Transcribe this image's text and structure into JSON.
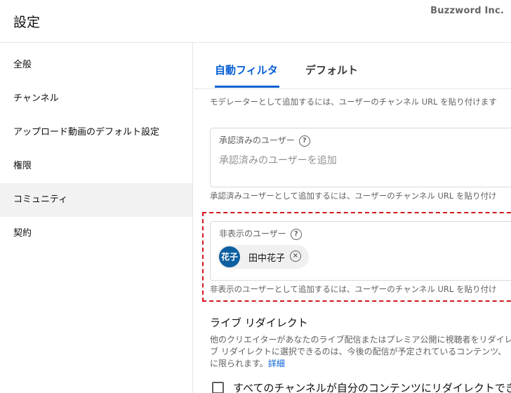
{
  "header": {
    "title": "設定",
    "watermark": "Buzzword Inc."
  },
  "sidebar": {
    "items": [
      {
        "label": "全般"
      },
      {
        "label": "チャンネル"
      },
      {
        "label": "アップロード動画のデフォルト設定"
      },
      {
        "label": "権限"
      },
      {
        "label": "コミュニティ"
      },
      {
        "label": "契約"
      }
    ],
    "active_item": "コミュニティ"
  },
  "tabs": [
    {
      "label": "自動フィルタ"
    },
    {
      "label": "デフォルト"
    }
  ],
  "moderators": {
    "helper": "モデレーターとして追加するには、ユーザーのチャンネル URL を貼り付けます"
  },
  "approved_users": {
    "label": "承認済みのユーザー",
    "help_glyph": "?",
    "placeholder": "承認済みのユーザーを追加",
    "value": "",
    "helper": "承認済みユーザーとして追加するには、ユーザーのチャンネル URL を貼り付け"
  },
  "hidden_users": {
    "label": "非表示のユーザー",
    "help_glyph": "?",
    "chip": {
      "avatar_text": "花子",
      "name": "田中花子",
      "remove_glyph": "×"
    },
    "helper": "非表示のユーザーとして追加するには、ユーザーのチャンネル URL を貼り付け"
  },
  "live_redirect": {
    "title": "ライブ リダイレクト",
    "desc_line1": "他のクリエイターがあなたのライブ配信またはプレミア公開に視聴者をリダイレ",
    "desc_line2": "ブ リダイレクトに選択できるのは、今後の配信が予定されているコンテンツ、",
    "desc_line3": "に限られます。",
    "details_link": "詳細",
    "checkbox_label": "すべてのチャンネルが自分のコンテンツにリダイレクトでき"
  },
  "colors": {
    "accent": "#065fd4",
    "highlight_border": "#d0181d",
    "avatar_bg": "#0d5fa0"
  }
}
